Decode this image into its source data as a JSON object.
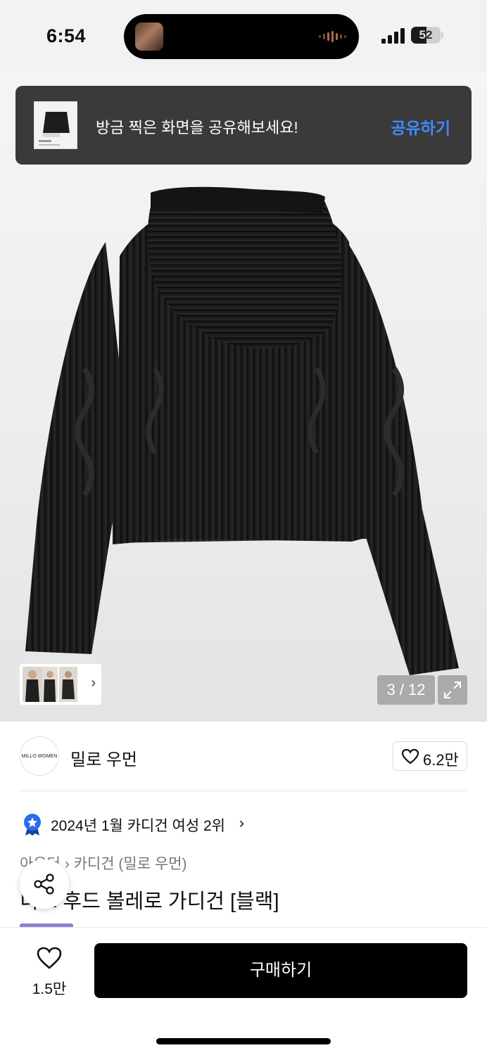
{
  "status_bar": {
    "time": "6:54",
    "battery_level": "52",
    "battery_fraction": 0.52
  },
  "toast": {
    "message": "방금 찍은 화면을 공유해보세요!",
    "action_label": "공유하기",
    "action_color": "#3d8bff"
  },
  "gallery": {
    "counter": "3 / 12",
    "current": 3,
    "total": 12,
    "more_icon": "chevron-right-icon",
    "expand_icon": "expand-icon"
  },
  "brand": {
    "logo_text": "MILLO WOMEN",
    "name": "밀로 우먼",
    "like_count": "6.2만"
  },
  "ranking": {
    "text": "2024년 1월 카디건 여성 2위"
  },
  "breadcrumb": {
    "category": "아우터",
    "subcategory": "카디건 (밀로 우먼)"
  },
  "product": {
    "title": "니트 후드 볼레로 가디건 [블랙]",
    "tag_color": "#8b7fd6"
  },
  "bottom_bar": {
    "wish_count": "1.5만",
    "buy_label": "구매하기"
  }
}
